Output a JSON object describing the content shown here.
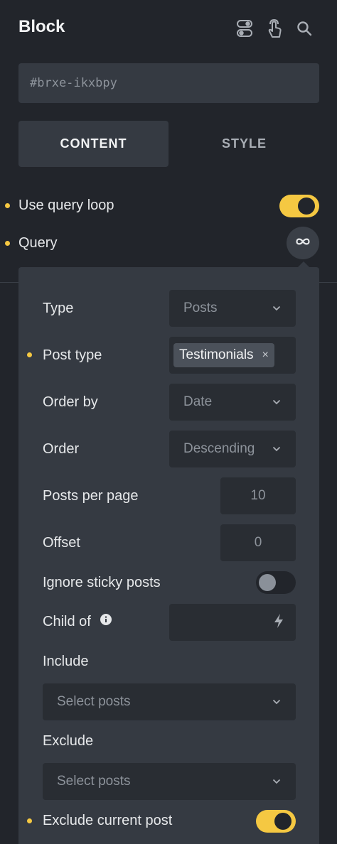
{
  "header": {
    "title": "Block",
    "icons": [
      "toggle-switch-icon",
      "pointer-hand-icon",
      "search-icon"
    ]
  },
  "id_field": {
    "placeholder": "#brxe-ikxbpy"
  },
  "tabs": [
    {
      "label": "CONTENT",
      "active": true
    },
    {
      "label": "STYLE",
      "active": false
    }
  ],
  "controls": {
    "use_query_loop": {
      "label": "Use query loop",
      "on": true
    },
    "query": {
      "label": "Query",
      "icon": "infinity-icon"
    }
  },
  "query_popup": {
    "type": {
      "label": "Type",
      "value": "Posts"
    },
    "post_type": {
      "label": "Post type",
      "tag": "Testimonials",
      "remove": "×"
    },
    "order_by": {
      "label": "Order by",
      "value": "Date"
    },
    "order": {
      "label": "Order",
      "value": "Descending"
    },
    "posts_per_page": {
      "label": "Posts per page",
      "placeholder": "10"
    },
    "offset": {
      "label": "Offset",
      "placeholder": "0"
    },
    "ignore_sticky": {
      "label": "Ignore sticky posts",
      "on": false
    },
    "child_of": {
      "label": "Child of",
      "info_icon": "info-icon",
      "dynamic_icon": "bolt-icon"
    },
    "include": {
      "label": "Include",
      "placeholder": "Select posts"
    },
    "exclude": {
      "label": "Exclude",
      "placeholder": "Select posts"
    },
    "exclude_current": {
      "label": "Exclude current post",
      "on": true
    }
  },
  "colors": {
    "accent": "#f5c842",
    "panel_bg": "#22252b",
    "popup_bg": "#353a42",
    "control_bg": "#292d33"
  }
}
